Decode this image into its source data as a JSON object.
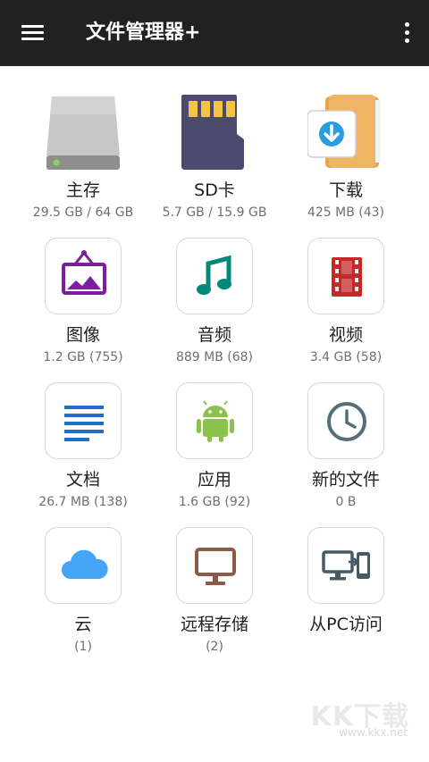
{
  "app_bar": {
    "title": "文件管理器+",
    "menu_icon": "hamburger-menu-icon",
    "more_icon": "more-vertical-icon",
    "background": "#212121"
  },
  "grid": {
    "items": [
      {
        "label": "主存",
        "sub": "29.5 GB / 64 GB",
        "icon": "internal-storage-icon"
      },
      {
        "label": "SD卡",
        "sub": "5.7 GB / 15.9 GB",
        "icon": "sd-card-icon"
      },
      {
        "label": "下载",
        "sub": "425 MB (43)",
        "icon": "download-folder-icon"
      },
      {
        "label": "图像",
        "sub": "1.2 GB (755)",
        "icon": "image-frame-icon",
        "color": "#7b1fa2"
      },
      {
        "label": "音频",
        "sub": "889 MB (68)",
        "icon": "music-note-icon",
        "color": "#00897b"
      },
      {
        "label": "视频",
        "sub": "3.4 GB (58)",
        "icon": "film-strip-icon",
        "color": "#c62828"
      },
      {
        "label": "文档",
        "sub": "26.7 MB (138)",
        "icon": "document-lines-icon",
        "color": "#1e6fd0"
      },
      {
        "label": "应用",
        "sub": "1.6 GB (92)",
        "icon": "android-icon",
        "color": "#8bc34a"
      },
      {
        "label": "新的文件",
        "sub": "0 B",
        "icon": "clock-icon",
        "color": "#546e7a"
      },
      {
        "label": "云",
        "sub": "(1)",
        "icon": "cloud-icon",
        "color": "#42a5f5"
      },
      {
        "label": "远程存储",
        "sub": "(2)",
        "icon": "monitor-icon",
        "color": "#8d5a4a"
      },
      {
        "label": "从PC访问",
        "sub": "",
        "icon": "pc-to-phone-icon",
        "color": "#455a64"
      }
    ]
  },
  "watermark": {
    "text": "KK下载",
    "url": "www.kkx.net"
  }
}
